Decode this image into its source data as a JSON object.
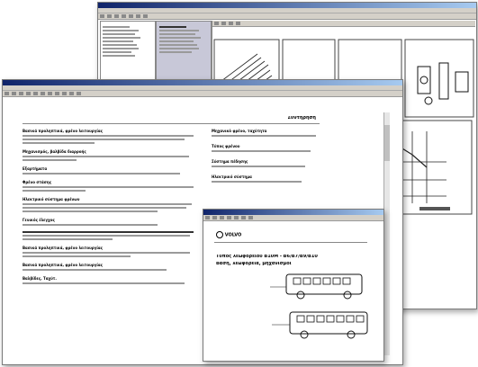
{
  "back_window": {
    "tree_items": [
      "",
      "",
      "",
      "",
      "",
      "",
      "",
      ""
    ]
  },
  "doc_window": {
    "page_heading": "Συντήρηση",
    "left_sections": [
      {
        "title": "Βασικά προληπτικά, φρένο λειτουργίας",
        "lines": 3
      },
      {
        "title": "Μηχανισμός, βαλβίδα διαρροής",
        "lines": 2
      },
      {
        "title": "Εξαρτήματα",
        "lines": 1
      },
      {
        "title": "Φρένο στάσης",
        "lines": 2
      },
      {
        "title": "Ηλεκτρικό σύστημα φρένων",
        "lines": 3
      },
      {
        "title": "Γενικός έλεγχος",
        "lines": 1
      },
      {
        "title": "",
        "lines": 3
      },
      {
        "title": "Βασικά προληπτικά, φρένο λειτουργίας",
        "lines": 2
      },
      {
        "title": "Βασικά προληπτικά, φρένο λειτουργίας",
        "lines": 1
      },
      {
        "title": "Βαλβίδες, Ταχύτ.",
        "lines": 1
      }
    ],
    "right_sections": [
      {
        "title": "Μηχανικό φρένο, ταχύτητα",
        "lines": 1
      },
      {
        "title": "Τύπος φρένου",
        "lines": 1
      },
      {
        "title": "Σύστημα πέδησης",
        "lines": 1
      },
      {
        "title": "Ηλεκτρικό σύστημα",
        "lines": 1
      }
    ]
  },
  "popup_window": {
    "logo_text": "VOLVO",
    "title_line1": "Τύπος λεωφορείου Β10Μ - Β6/Β7/Β9/Β10",
    "title_line2": "Βάση, λεωφορεία, μηχανισμοί"
  }
}
